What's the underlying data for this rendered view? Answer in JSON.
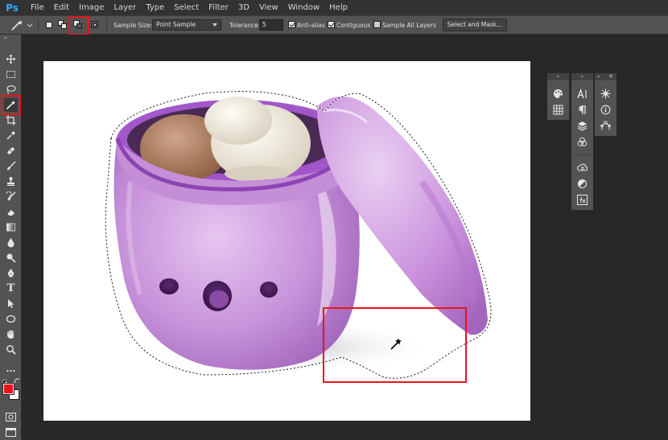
{
  "app": {
    "logo": "Ps"
  },
  "menu": [
    "File",
    "Edit",
    "Image",
    "Layer",
    "Type",
    "Select",
    "Filter",
    "3D",
    "View",
    "Window",
    "Help"
  ],
  "options_bar": {
    "sample_size_label": "Sample Size:",
    "sample_size_value": "Point Sample",
    "tolerance_label": "Tolerance:",
    "tolerance_value": "5",
    "anti_alias_label": "Anti-alias",
    "contiguous_label": "Contiguous",
    "sample_all_layers_label": "Sample All Layers",
    "select_and_mask_label": "Select and Mask...",
    "anti_alias_checked": true,
    "contiguous_checked": true,
    "sample_all_layers_checked": false
  },
  "tools": [
    "move-tool-icon",
    "marquee-tool-icon",
    "lasso-tool-icon",
    "magic-wand-tool-icon",
    "crop-tool-icon",
    "eyedropper-tool-icon",
    "healing-brush-icon",
    "brush-tool-icon",
    "clone-stamp-icon",
    "history-brush-icon",
    "eraser-tool-icon",
    "gradient-tool-icon",
    "blur-tool-icon",
    "dodge-tool-icon",
    "pen-tool-icon",
    "type-tool-icon",
    "path-selection-icon",
    "ellipse-tool-icon",
    "hand-tool-icon",
    "zoom-tool-icon"
  ],
  "type_tool_glyph": "T",
  "colors": {
    "foreground": "#e8141c",
    "background": "#ffffff",
    "highlight": "#e8141c",
    "ui_dark": "#282828",
    "ui_panel": "#535353",
    "product_purple": "#c48fd6"
  },
  "dock_icons": {
    "left": [
      "color-icon",
      "swatches-icon"
    ],
    "middle": [
      "character-icon",
      "paragraph-icon",
      "layers-icon",
      "channels-icon",
      "libraries-icon",
      "adjustments-icon",
      "styles-icon"
    ],
    "right": [
      "navigator-icon",
      "info-icon",
      "paths-icon"
    ]
  }
}
